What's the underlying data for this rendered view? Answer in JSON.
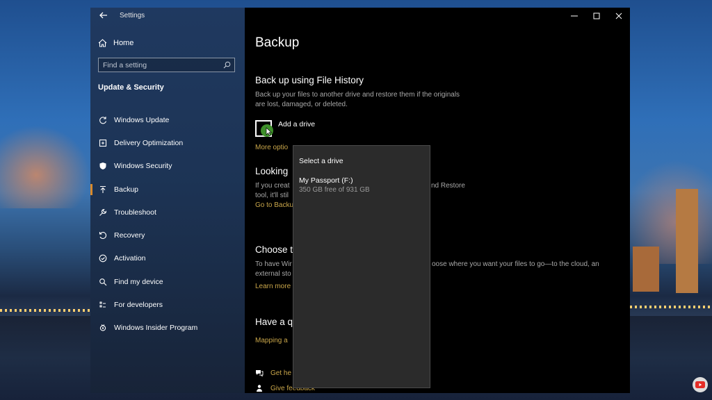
{
  "window": {
    "title": "Settings"
  },
  "sidebar": {
    "home_label": "Home",
    "search_placeholder": "Find a setting",
    "section_heading": "Update & Security",
    "items": [
      {
        "label": "Windows Update",
        "icon": "refresh-icon"
      },
      {
        "label": "Delivery Optimization",
        "icon": "delivery-optimization-icon"
      },
      {
        "label": "Windows Security",
        "icon": "shield-icon"
      },
      {
        "label": "Backup",
        "icon": "backup-arrow-icon",
        "active": true
      },
      {
        "label": "Troubleshoot",
        "icon": "wrench-icon"
      },
      {
        "label": "Recovery",
        "icon": "recovery-icon"
      },
      {
        "label": "Activation",
        "icon": "check-circle-icon"
      },
      {
        "label": "Find my device",
        "icon": "find-device-icon"
      },
      {
        "label": "For developers",
        "icon": "developer-icon"
      },
      {
        "label": "Windows Insider Program",
        "icon": "insider-icon"
      }
    ]
  },
  "content": {
    "page_title": "Backup",
    "file_history": {
      "heading": "Back up using File History",
      "description_line1": "Back up your files to another drive and restore them if the originals",
      "description_line2": "are lost, damaged, or deleted.",
      "add_drive_label": "Add a drive",
      "more_options_link": "More optio"
    },
    "looking": {
      "heading": "Looking",
      "line1_left": "If you creat",
      "line1_right": "nd Restore",
      "line2": "tool, it'll stil",
      "link": "Go to Backu"
    },
    "choose": {
      "heading": "Choose t",
      "line1_left": "To have Wir",
      "line1_right": "oose where you want your files to go—to the cloud, an",
      "line2": "external sto",
      "link": "Learn more"
    },
    "question": {
      "heading": "Have a q",
      "link": "Mapping a"
    },
    "footer": {
      "help_link": "Get he",
      "feedback_link": "Give feedback"
    }
  },
  "flyout": {
    "title": "Select a drive",
    "drives": [
      {
        "name": "My Passport (F:)",
        "space": "350 GB free of 931 GB"
      }
    ]
  },
  "colors": {
    "accent": "#d98a2b",
    "link": "#c9a64a",
    "content_bg": "#000000",
    "flyout_bg": "#2b2b2b"
  }
}
